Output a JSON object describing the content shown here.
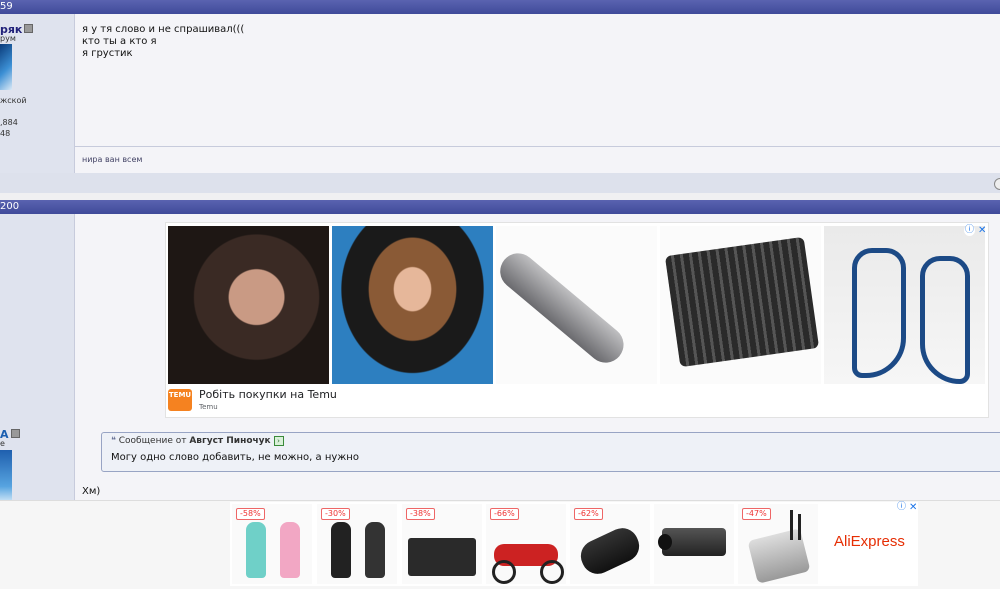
{
  "post1": {
    "header_text": "59",
    "username": "ряк",
    "user_title": "рум",
    "location": "жской",
    "stat1": ",884",
    "stat2": "48",
    "message_lines": [
      "я у тя слово и не спрашивал(((",
      "кто ты а кто я",
      "я грустик"
    ],
    "signature": "нира ван всем"
  },
  "post2": {
    "header_text": "200",
    "username": "А",
    "user_title": "е",
    "quote_prefix": "Сообщение от",
    "quote_author": "Август Пиночук",
    "quote_text": "Могу одно слово добавить, не можно, а нужно",
    "reply_text": "Хм)"
  },
  "temu_ad": {
    "title": "Робіть покупки на Temu",
    "source": "Temu",
    "logo_text": "TEMU",
    "info_icon": "info-icon",
    "close_icon": "close-icon"
  },
  "aliexpress_ad": {
    "brand": "AliExpress",
    "discounts": [
      "-58%",
      "-30%",
      "-38%",
      "-66%",
      "-62%",
      "",
      "-47%"
    ]
  },
  "colors": {
    "header_bar": "#4a54a4",
    "user_pane": "#dfe3ee",
    "message_pane": "#f4f4f8",
    "aliexpress_red": "#e62e04",
    "temu_orange": "#f58220"
  }
}
